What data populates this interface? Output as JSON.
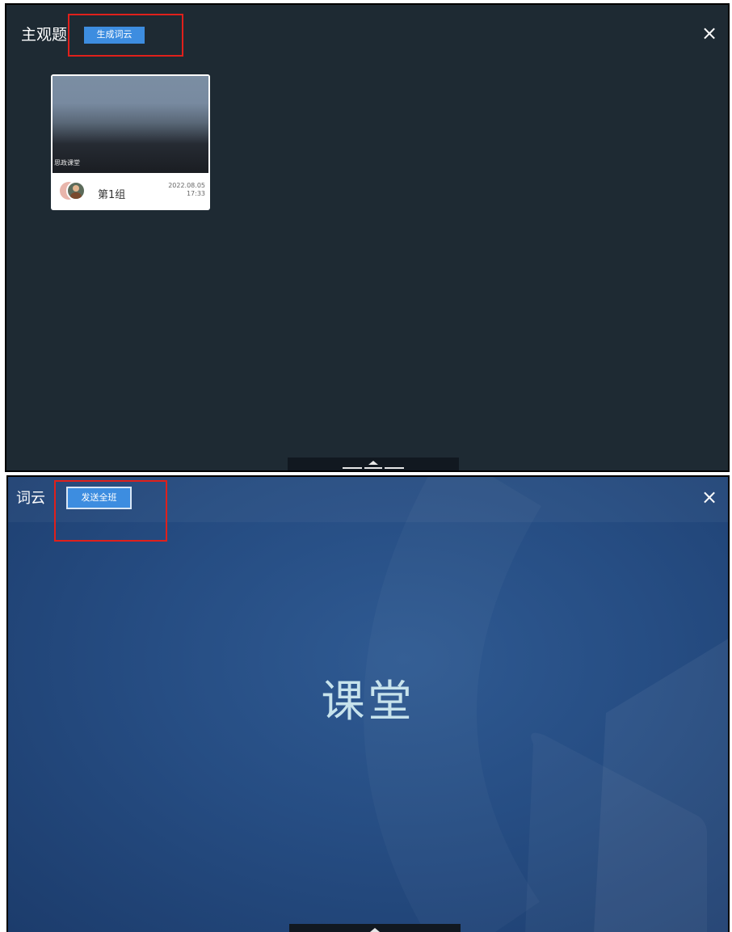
{
  "panel_subjective": {
    "title": "主观题",
    "generate_button": "生成词云",
    "close_icon": "×",
    "card": {
      "caption": "思政课堂",
      "group_name": "第1组",
      "date": "2022.08.05",
      "time": "17:33"
    }
  },
  "panel_wordcloud": {
    "title": "词云",
    "send_button": "发送全班",
    "close_icon": "×",
    "word": "课堂"
  },
  "colors": {
    "panel1_bg": "#1e2a33",
    "panel2_bg": "#264d83",
    "button": "#3d8de0",
    "highlight": "#e0201b",
    "word": "#c7e3ec"
  }
}
